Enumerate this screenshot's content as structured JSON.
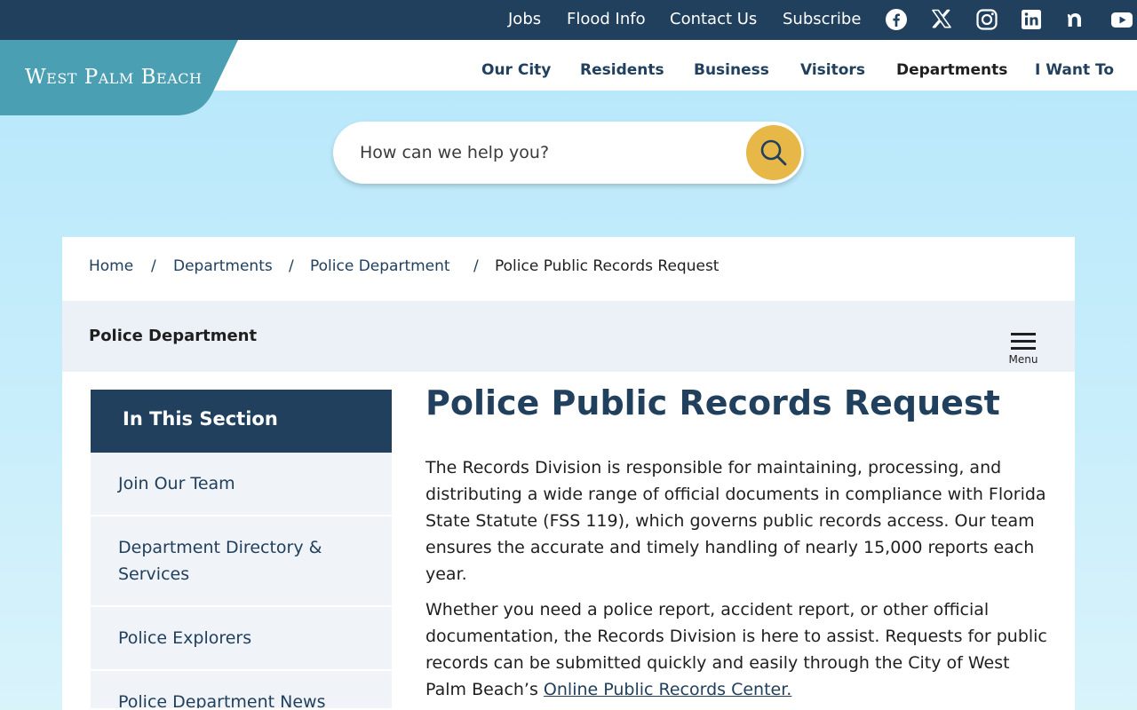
{
  "utility_nav": {
    "links": [
      "Jobs",
      "Flood Info",
      "Contact Us",
      "Subscribe"
    ],
    "social_icons": [
      "facebook-icon",
      "x-twitter-icon",
      "instagram-icon",
      "linkedin-icon",
      "nextdoor-icon",
      "youtube-icon"
    ]
  },
  "header": {
    "logo_text": "West Palm Beach",
    "nav": [
      "Our City",
      "Residents",
      "Business",
      "Visitors",
      "Departments",
      "I Want To"
    ]
  },
  "search": {
    "placeholder": "How can we help you?",
    "button_icon": "search-icon"
  },
  "breadcrumb": {
    "items": [
      "Home",
      "Departments",
      "Police Department"
    ],
    "separator": "/",
    "current": "Police Public Records Request"
  },
  "section": {
    "title": "Police Department",
    "menu_label": "Menu"
  },
  "sidebar": {
    "heading": "In This Section",
    "items": [
      "Join Our Team",
      "Department Directory & Services",
      "Police Explorers",
      "Police Department News"
    ]
  },
  "main": {
    "title": "Police Public Records Request",
    "paragraph1": "The Records Division is responsible for maintaining, processing, and distributing a wide range of official documents in compliance with Florida State Statute (FSS 119), which governs public records access. Our team ensures the accurate and timely handling of nearly 15,000 reports each year.",
    "paragraph2": "Whether you need a police report, accident report, or other official documentation, the Records Division is here to assist. Requests for public records can be submitted quickly and easily through the City of West Palm Beach’s ",
    "paragraph2_link": "Online Public Records Center."
  },
  "colors": {
    "navy": "#21405e",
    "teal_logo": "#4a9fb2",
    "search_accent": "#e7b748",
    "sky_background": "#b5e7fb"
  }
}
